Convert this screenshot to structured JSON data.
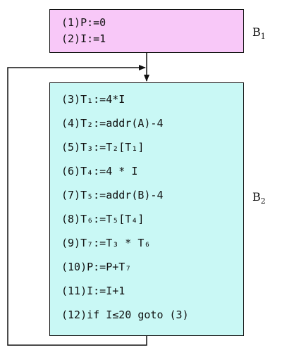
{
  "blocks": [
    {
      "id": "B1",
      "label": "B",
      "label_sub": "1",
      "fill": "#f8c8f8",
      "statements": [
        "(1)P:=0",
        "(2)I:=1"
      ]
    },
    {
      "id": "B2",
      "label": "B",
      "label_sub": "2",
      "fill": "#c9f8f5",
      "statements": [
        "(3)T₁:=4*I",
        "(4)T₂:=addr(A)-4",
        "(5)T₃:=T₂[T₁]",
        "(6)T₄:=4 * I",
        "(7)T₅:=addr(B)-4",
        "(8)T₆:=T₅[T₄]",
        "(9)T₇:=T₃ * T₆",
        "(10)P:=P+T₇",
        "(11)I:=I+1",
        "(12)if I≤20 goto (3)"
      ]
    }
  ],
  "edges": [
    {
      "from": "B1",
      "to": "B2"
    },
    {
      "from": "B2",
      "to": "B2",
      "type": "loop-back"
    }
  ]
}
